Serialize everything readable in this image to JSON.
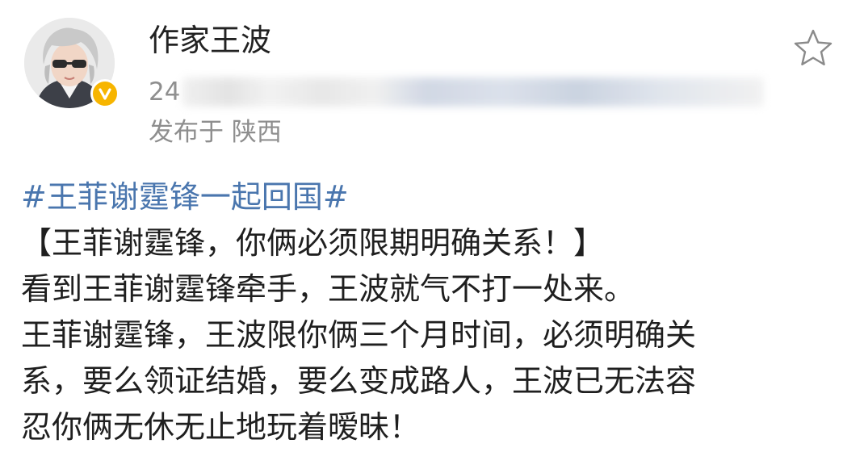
{
  "post": {
    "author": {
      "name": "作家王波",
      "avatar_icon": "avatar-photo",
      "verified_icon": "verified-check-icon",
      "verified_color": "#f7b500"
    },
    "time_visible": "24",
    "location": "发布于 陕西",
    "favorite_icon": "star-outline-icon",
    "hashtag": "#王菲谢霆锋一起回国#",
    "hashtag_color": "#4a76ae",
    "body_lines": [
      "【王菲谢霆锋，你俩必须限期明确关系！】",
      "看到王菲谢霆锋牵手，王波就气不打一处来。",
      "王菲谢霆锋，王波限你俩三个月时间，必须明确关",
      "系，要么领证结婚，要么变成路人，王波已无法容",
      "忍你俩无休无止地玩着暧昧！"
    ]
  }
}
